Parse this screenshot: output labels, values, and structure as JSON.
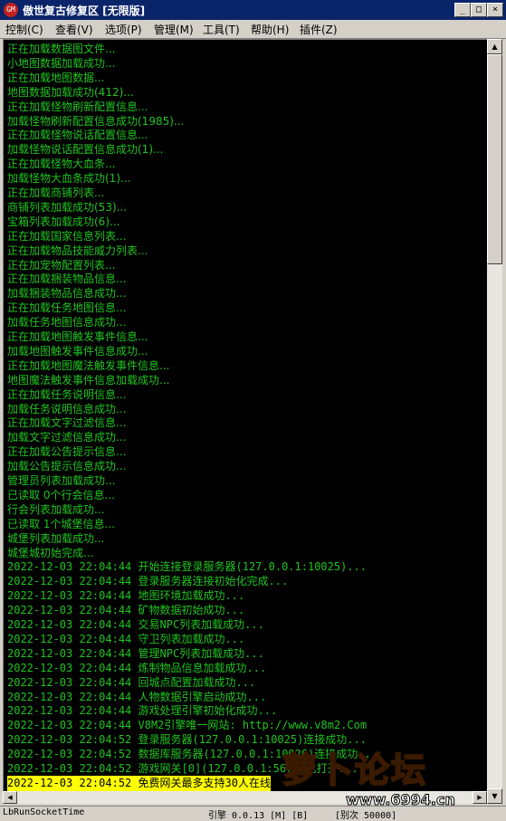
{
  "window": {
    "icon_text": "GM",
    "title": "傲世复古修复区 [无限版]",
    "min": "_",
    "max": "□",
    "close": "×"
  },
  "menu": [
    "控制(C)",
    "查看(V)",
    "选项(P)",
    "管理(M)",
    "工具(T)",
    "帮助(H)",
    "插件(Z)"
  ],
  "log_lines": [
    {
      "text": "正在加载数据图文件..."
    },
    {
      "text": "小地图数据加载成功..."
    },
    {
      "text": "正在加载地图数据..."
    },
    {
      "text": "地图数据加载成功(412)..."
    },
    {
      "text": "正在加载怪物刷新配置信息..."
    },
    {
      "text": "加载怪物刷新配置信息成功(1985)..."
    },
    {
      "text": "正在加载怪物说话配置信息..."
    },
    {
      "text": "加载怪物说话配置信息成功(1)..."
    },
    {
      "text": "正在加载怪物大血条..."
    },
    {
      "text": "加载怪物大血条成功(1)..."
    },
    {
      "text": "正在加载商铺列表..."
    },
    {
      "text": "商铺列表加载成功(53)..."
    },
    {
      "text": "宝箱列表加载成功(6)..."
    },
    {
      "text": "正在加载国家信息列表..."
    },
    {
      "text": "正在加载物品技能威力列表..."
    },
    {
      "text": "正在加宠物配置列表..."
    },
    {
      "text": "正在加载捆装物品信息..."
    },
    {
      "text": "加载捆装物品信息成功..."
    },
    {
      "text": "正在加载任务地图信息..."
    },
    {
      "text": "加载任务地图信息成功..."
    },
    {
      "text": "正在加载地图触发事件信息..."
    },
    {
      "text": "加载地图触发事件信息成功..."
    },
    {
      "text": "正在加载地图魔法触发事件信息..."
    },
    {
      "text": "地图魔法触发事件信息加载成功..."
    },
    {
      "text": "正在加载任务说明信息..."
    },
    {
      "text": "加载任务说明信息成功..."
    },
    {
      "text": "正在加载文字过滤信息..."
    },
    {
      "text": "加载文字过滤信息成功..."
    },
    {
      "text": "正在加载公告提示信息..."
    },
    {
      "text": "加载公告提示信息成功..."
    },
    {
      "text": "管理员列表加载成功..."
    },
    {
      "text": "已读取 0个行会信息..."
    },
    {
      "text": "行会列表加载成功..."
    },
    {
      "text": "已读取 1个城堡信息..."
    },
    {
      "text": "城堡列表加载成功..."
    },
    {
      "text": "城堡城初始完成..."
    },
    {
      "text": "2022-12-03 22:04:44 开始连接登录服务器(127.0.0.1:10025)...",
      "ts": true
    },
    {
      "text": "2022-12-03 22:04:44 登录服务器连接初始化完成...",
      "ts": true
    },
    {
      "text": "2022-12-03 22:04:44 地图环境加载成功...",
      "ts": true
    },
    {
      "text": "2022-12-03 22:04:44 矿物数据初始成功...",
      "ts": true
    },
    {
      "text": "2022-12-03 22:04:44 交易NPC列表加载成功...",
      "ts": true
    },
    {
      "text": "2022-12-03 22:04:44 守卫列表加载成功...",
      "ts": true
    },
    {
      "text": "2022-12-03 22:04:44 管理NPC列表加载成功...",
      "ts": true
    },
    {
      "text": "2022-12-03 22:04:44 炼制物品信息加载成功...",
      "ts": true
    },
    {
      "text": "2022-12-03 22:04:44 回城点配置加载成功...",
      "ts": true
    },
    {
      "text": "2022-12-03 22:04:44 人物数据引擎启动成功...",
      "ts": true
    },
    {
      "text": "2022-12-03 22:04:44 游戏处理引擎初始化成功...",
      "ts": true
    },
    {
      "text": "2022-12-03 22:04:44 V8M2引擎唯一网站: http://www.v8m2.Com",
      "ts": true
    },
    {
      "text": "2022-12-03 22:04:52 登录服务器(127.0.0.1:10025)连接成功...",
      "ts": true
    },
    {
      "text": "2022-12-03 22:04:52 数据库服务器(127.0.0.1:10026)连接成功...",
      "ts": true
    },
    {
      "text": "2022-12-03 22:04:52 游戏网关[0](127.0.0.1:5678)已打开...",
      "ts": true
    },
    {
      "text": "2022-12-03 22:04:52 免费网关最多支持30人在线",
      "ts": true,
      "hl": true
    },
    {
      "text": "2022-12-03 22:04:52 免费网关最多支持30人在线",
      "ts": true,
      "hl": true
    }
  ],
  "status": {
    "c1": "LbRunSocketTime",
    "c2": "引擎 0.0.13 [M] [B]",
    "c3": "[别次 50000]"
  },
  "watermark": {
    "brand": "萝卜论坛",
    "url": "www.6994.cn"
  },
  "colors": {
    "log_text": "#21c321",
    "highlight_bg": "#ffff00",
    "title_bar": "#0a246a"
  }
}
